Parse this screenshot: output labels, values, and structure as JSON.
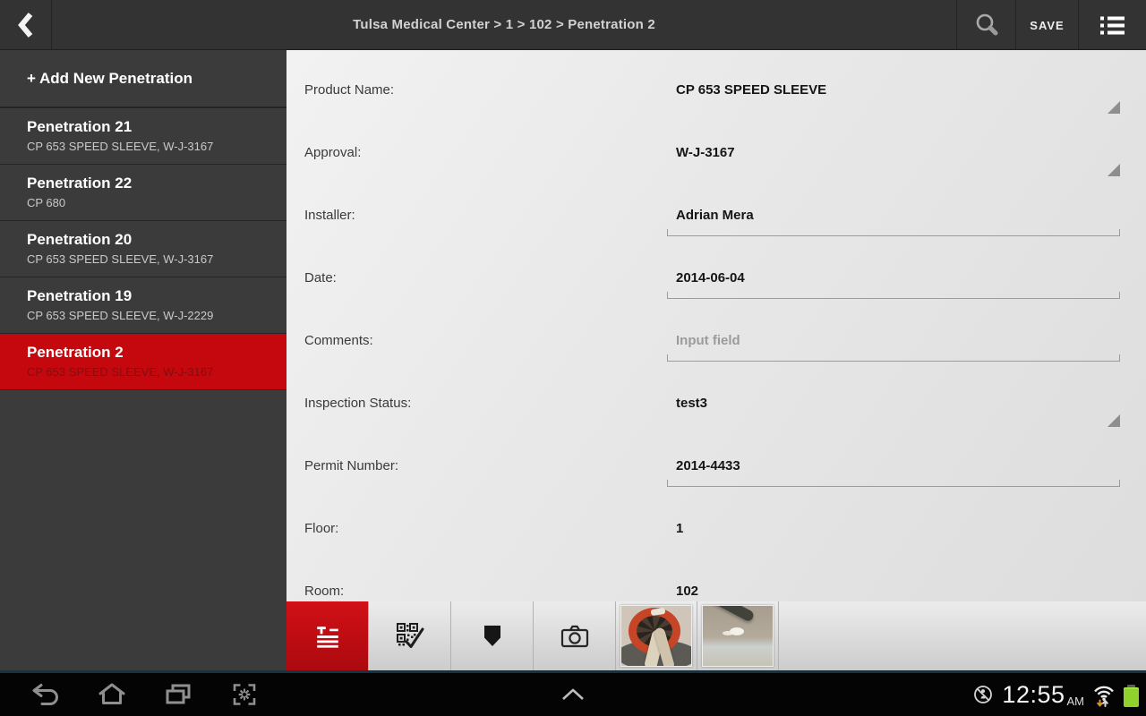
{
  "topbar": {
    "breadcrumb": "Tulsa Medical Center > 1 > 102 > Penetration 2",
    "save_label": "SAVE"
  },
  "sidebar": {
    "add_new_label": "+ Add New Penetration",
    "items": [
      {
        "title": "Penetration 21",
        "subtitle": "CP 653 SPEED SLEEVE, W-J-3167",
        "selected": false
      },
      {
        "title": "Penetration 22",
        "subtitle": "CP 680",
        "selected": false
      },
      {
        "title": "Penetration 20",
        "subtitle": "CP 653 SPEED SLEEVE, W-J-3167",
        "selected": false
      },
      {
        "title": "Penetration 19",
        "subtitle": "CP 653 SPEED SLEEVE, W-J-2229",
        "selected": false
      },
      {
        "title": "Penetration 2",
        "subtitle": "CP 653 SPEED SLEEVE, W-J-3167",
        "selected": true
      }
    ]
  },
  "form": {
    "fields": [
      {
        "id": "product-name",
        "label": "Product Name:",
        "value": "CP 653 SPEED SLEEVE",
        "type": "dropdown"
      },
      {
        "id": "approval",
        "label": "Approval:",
        "value": "W-J-3167",
        "type": "dropdown"
      },
      {
        "id": "installer",
        "label": "Installer:",
        "value": "Adrian Mera",
        "type": "input"
      },
      {
        "id": "date",
        "label": "Date:",
        "value": "2014-06-04",
        "type": "input"
      },
      {
        "id": "comments",
        "label": "Comments:",
        "value": "",
        "placeholder": "Input field",
        "type": "input"
      },
      {
        "id": "inspection-status",
        "label": "Inspection Status:",
        "value": "test3",
        "type": "dropdown"
      },
      {
        "id": "permit-number",
        "label": "Permit Number:",
        "value": "2014-4433",
        "type": "input"
      },
      {
        "id": "floor",
        "label": "Floor:",
        "value": "1",
        "type": "static"
      },
      {
        "id": "room",
        "label": "Room:",
        "value": "102",
        "type": "static"
      }
    ]
  },
  "toolbar": {
    "buttons": [
      {
        "id": "details",
        "icon": "form-list-icon",
        "selected": true
      },
      {
        "id": "qr-verify",
        "icon": "qr-check-icon",
        "selected": false
      },
      {
        "id": "tag",
        "icon": "shield-icon",
        "selected": false
      },
      {
        "id": "camera",
        "icon": "camera-icon",
        "selected": false
      }
    ],
    "photos": [
      {
        "id": "photo-speed-sleeve"
      },
      {
        "id": "photo-floor-cable"
      }
    ]
  },
  "statusbar": {
    "time": "12:55",
    "meridiem": "AM"
  },
  "colors": {
    "accent_red": "#c5080d",
    "topbar_bg": "#333333",
    "sidebar_bg": "#3b3b3b",
    "battery_green": "#8ed22b",
    "edge_teal": "#123543"
  }
}
